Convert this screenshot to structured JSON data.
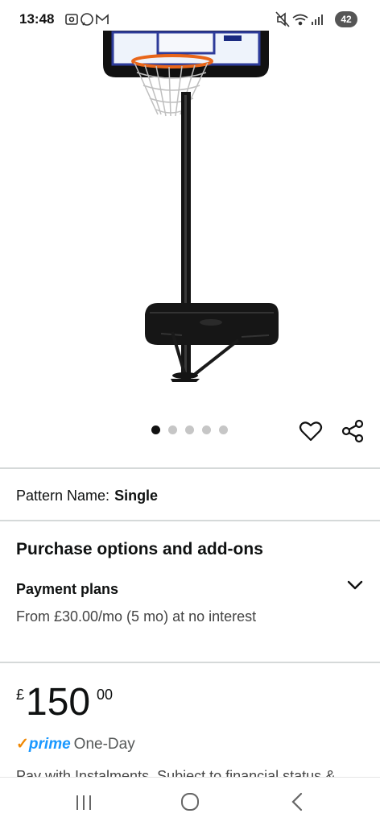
{
  "status_bar": {
    "time": "13:48",
    "left_icons": [
      "screenshot-icon",
      "whatsapp-icon",
      "gmail-icon"
    ],
    "right_icons": [
      "mute-icon",
      "wifi-icon",
      "signal-icon"
    ],
    "battery": "42"
  },
  "gallery": {
    "image_alt": "basketball-hoop-product-image",
    "dot_count": 5,
    "active_dot": 0
  },
  "actions": {
    "wishlist_icon": "heart-icon",
    "share_icon": "share-icon"
  },
  "pattern": {
    "label": "Pattern Name:",
    "value": "Single"
  },
  "purchase": {
    "title": "Purchase options and add-ons",
    "payment_plans_title": "Payment plans",
    "payment_plans_desc": "From £30.00/mo (5 mo) at no interest"
  },
  "price": {
    "currency": "£",
    "whole": "150",
    "fraction": "00"
  },
  "delivery": {
    "check": "✓",
    "prime": "prime",
    "speed": "One-Day"
  },
  "truncated_text": "Pay with Instalments. Subject to financial status &",
  "colors": {
    "prime_blue": "#1a98ff",
    "prime_orange": "#f08804",
    "divider": "#d5d9d9"
  }
}
